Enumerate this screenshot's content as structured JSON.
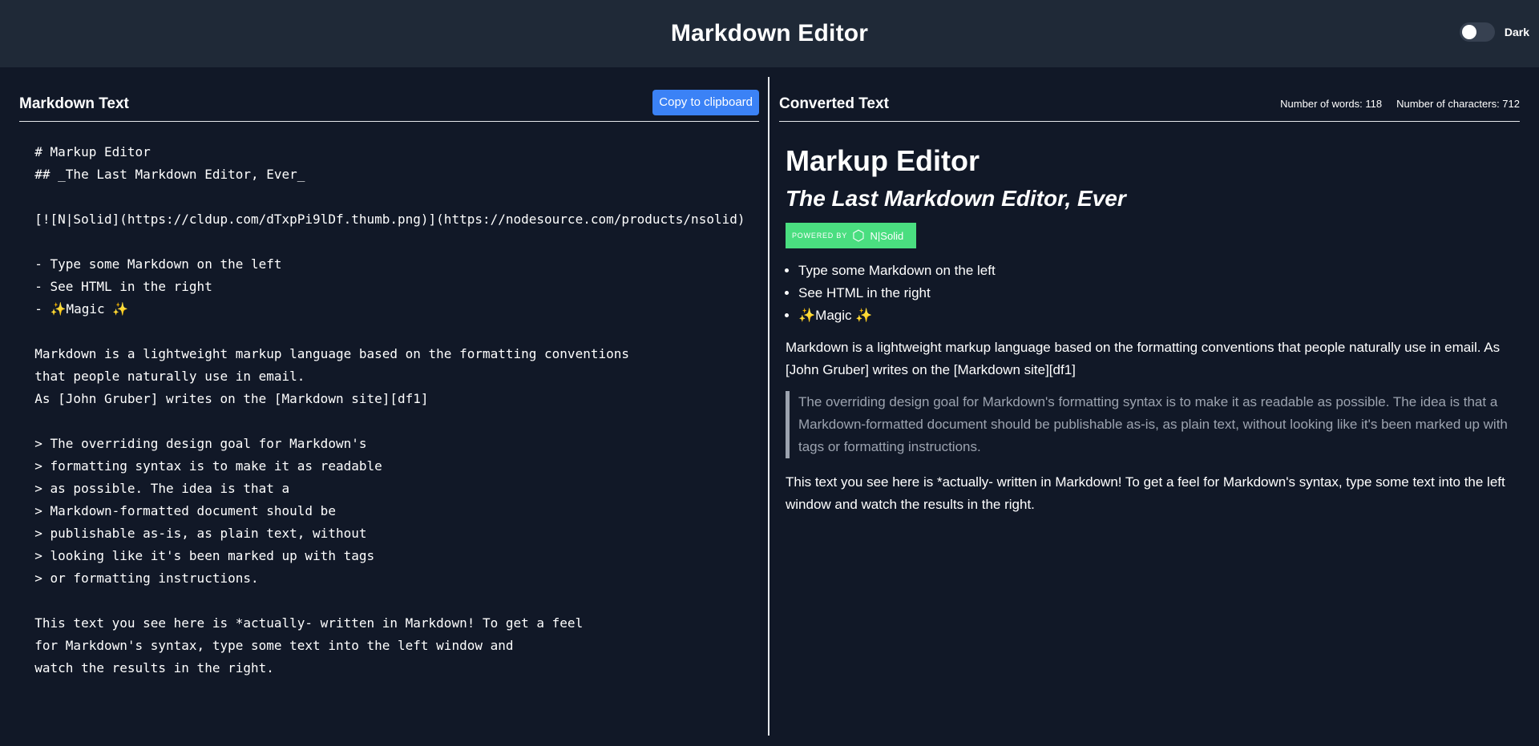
{
  "app": {
    "title": "Markdown Editor",
    "theme_label": "Dark"
  },
  "left": {
    "title": "Markdown Text",
    "copy_label": "Copy to clipboard",
    "markdown": "  # Markup Editor\n  ## _The Last Markdown Editor, Ever_\n\n  [![N|Solid](https://cldup.com/dTxpPi9lDf.thumb.png)](https://nodesource.com/products/nsolid)\n\n  - Type some Markdown on the left\n  - See HTML in the right\n  - ✨Magic ✨\n\n  Markdown is a lightweight markup language based on the formatting conventions\n  that people naturally use in email.\n  As [John Gruber] writes on the [Markdown site][df1]\n\n  > The overriding design goal for Markdown's\n  > formatting syntax is to make it as readable\n  > as possible. The idea is that a\n  > Markdown-formatted document should be\n  > publishable as-is, as plain text, without\n  > looking like it's been marked up with tags\n  > or formatting instructions.\n\n  This text you see here is *actually- written in Markdown! To get a feel\n  for Markdown's syntax, type some text into the left window and\n  watch the results in the right."
  },
  "right": {
    "title": "Converted Text",
    "words_label": "Number of words: 118",
    "chars_label": "Number of characters: 712",
    "h1": "Markup Editor",
    "h2": "The Last Markdown Editor, Ever",
    "badge": {
      "powered_by": "POWERED BY",
      "brand": "N|Solid"
    },
    "list": [
      "Type some Markdown on the left",
      "See HTML in the right",
      "✨Magic ✨"
    ],
    "paragraph1": "Markdown is a lightweight markup language based on the formatting conventions that people naturally use in email. As [John Gruber] writes on the [Markdown site][df1]",
    "blockquote": "The overriding design goal for Markdown's formatting syntax is to make it as readable as possible. The idea is that a Markdown-formatted document should be publishable as-is, as plain text, without looking like it's been marked up with tags or formatting instructions.",
    "paragraph2": "This text you see here is *actually- written in Markdown! To get a feel for Markdown's syntax, type some text into the left window and watch the results in the right."
  },
  "colors": {
    "background": "#111827",
    "header": "#1f2937",
    "accent": "#3b82f6",
    "badge": "#4ade80",
    "quote": "#9ca3af"
  }
}
